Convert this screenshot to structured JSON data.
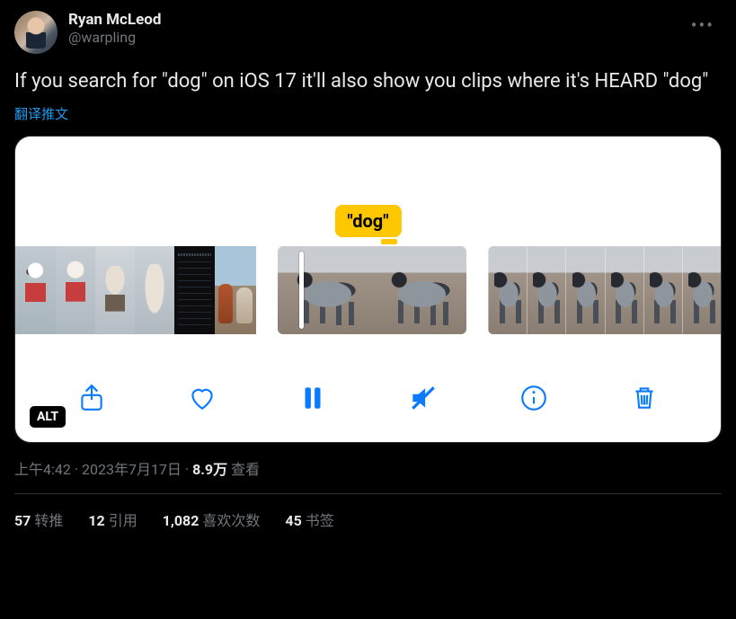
{
  "author": {
    "display_name": "Ryan McLeod",
    "handle": "@warpling"
  },
  "tweet_text": "If you search for \"dog\" on iOS 17 it'll also show you clips where it's HEARD \"dog\"",
  "translate_label": "翻译推文",
  "media": {
    "caption_label": "\"dog\"",
    "alt_badge": "ALT"
  },
  "meta": {
    "time": "上午4:42",
    "date": "2023年7月17日",
    "views_number": "8.9万",
    "views_label": "查看"
  },
  "stats": {
    "retweets_num": "57",
    "retweets_label": "转推",
    "quotes_num": "12",
    "quotes_label": "引用",
    "likes_num": "1,082",
    "likes_label": "喜欢次数",
    "bookmarks_num": "45",
    "bookmarks_label": "书签"
  }
}
